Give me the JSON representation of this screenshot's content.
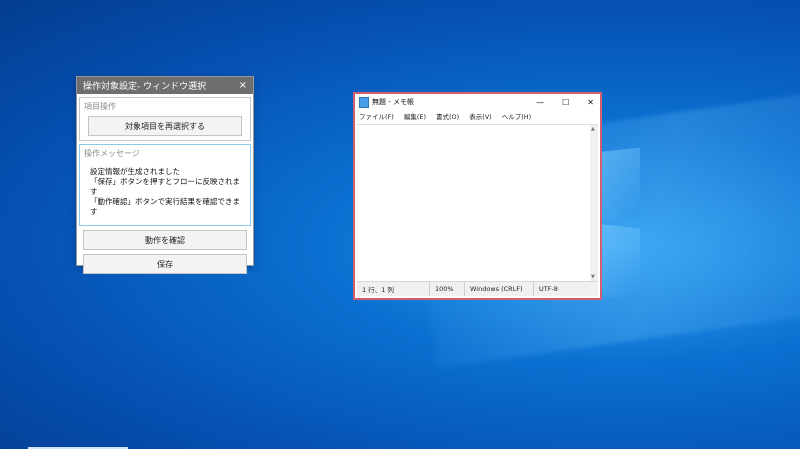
{
  "panel": {
    "title": "操作対象設定- ウィンドウ選択",
    "close_glyph": "×",
    "item_group_label": "項目操作",
    "reselect_label": "対象項目を再選択する",
    "message_group_label": "操作メッセージ",
    "messages": [
      "設定情報が生成されました",
      "「保存」ボタンを押すとフローに反映されます",
      "「動作確認」ボタンで実行結果を確認できます"
    ],
    "verify_label": "動作を確認",
    "save_label": "保存"
  },
  "notepad": {
    "title": "無題 - メモ帳",
    "controls": {
      "minimize": "—",
      "maximize": "☐",
      "close": "✕"
    },
    "menu": [
      "ファイル(F)",
      "編集(E)",
      "書式(O)",
      "表示(V)",
      "ヘルプ(H)"
    ],
    "status": {
      "position": "1 行、1 列",
      "zoom": "100%",
      "line_ending": "Windows (CRLF)",
      "encoding": "UTF-8"
    }
  },
  "colors": {
    "desktop_blue": "#0a6fd0",
    "panel_title": "#6e6e6e",
    "highlight_border": "#d06070"
  }
}
